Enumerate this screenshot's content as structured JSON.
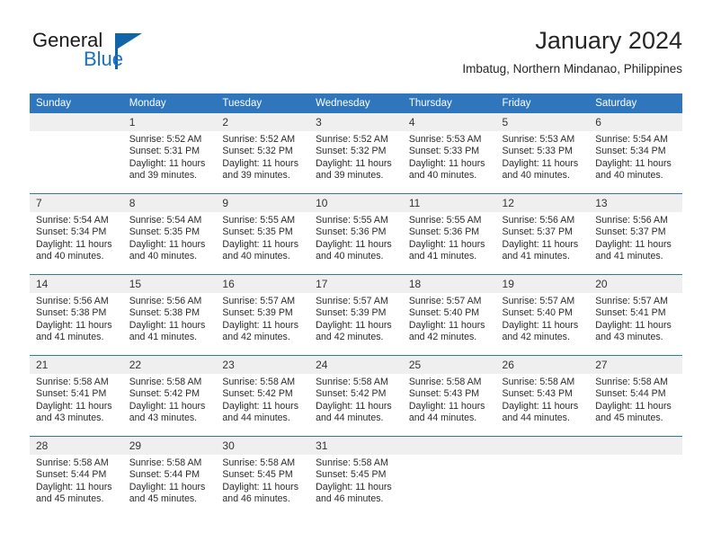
{
  "logo": {
    "word_one": "General",
    "word_two": "Blue",
    "icon": "triangle-icon",
    "accent_color": "#1064a8"
  },
  "header": {
    "month_title": "January 2024",
    "location": "Imbatug, Northern Mindanao, Philippines"
  },
  "theme": {
    "header_bar_color": "#2f76bc",
    "daynum_band_color": "#efefef",
    "text_color": "#2b2b2b"
  },
  "weekday_headers": [
    "Sunday",
    "Monday",
    "Tuesday",
    "Wednesday",
    "Thursday",
    "Friday",
    "Saturday"
  ],
  "weeks": [
    [
      {
        "day": "",
        "sunrise": "",
        "sunset": "",
        "daylight_line1": "",
        "daylight_line2": ""
      },
      {
        "day": "1",
        "sunrise": "Sunrise: 5:52 AM",
        "sunset": "Sunset: 5:31 PM",
        "daylight_line1": "Daylight: 11 hours",
        "daylight_line2": "and 39 minutes."
      },
      {
        "day": "2",
        "sunrise": "Sunrise: 5:52 AM",
        "sunset": "Sunset: 5:32 PM",
        "daylight_line1": "Daylight: 11 hours",
        "daylight_line2": "and 39 minutes."
      },
      {
        "day": "3",
        "sunrise": "Sunrise: 5:52 AM",
        "sunset": "Sunset: 5:32 PM",
        "daylight_line1": "Daylight: 11 hours",
        "daylight_line2": "and 39 minutes."
      },
      {
        "day": "4",
        "sunrise": "Sunrise: 5:53 AM",
        "sunset": "Sunset: 5:33 PM",
        "daylight_line1": "Daylight: 11 hours",
        "daylight_line2": "and 40 minutes."
      },
      {
        "day": "5",
        "sunrise": "Sunrise: 5:53 AM",
        "sunset": "Sunset: 5:33 PM",
        "daylight_line1": "Daylight: 11 hours",
        "daylight_line2": "and 40 minutes."
      },
      {
        "day": "6",
        "sunrise": "Sunrise: 5:54 AM",
        "sunset": "Sunset: 5:34 PM",
        "daylight_line1": "Daylight: 11 hours",
        "daylight_line2": "and 40 minutes."
      }
    ],
    [
      {
        "day": "7",
        "sunrise": "Sunrise: 5:54 AM",
        "sunset": "Sunset: 5:34 PM",
        "daylight_line1": "Daylight: 11 hours",
        "daylight_line2": "and 40 minutes."
      },
      {
        "day": "8",
        "sunrise": "Sunrise: 5:54 AM",
        "sunset": "Sunset: 5:35 PM",
        "daylight_line1": "Daylight: 11 hours",
        "daylight_line2": "and 40 minutes."
      },
      {
        "day": "9",
        "sunrise": "Sunrise: 5:55 AM",
        "sunset": "Sunset: 5:35 PM",
        "daylight_line1": "Daylight: 11 hours",
        "daylight_line2": "and 40 minutes."
      },
      {
        "day": "10",
        "sunrise": "Sunrise: 5:55 AM",
        "sunset": "Sunset: 5:36 PM",
        "daylight_line1": "Daylight: 11 hours",
        "daylight_line2": "and 40 minutes."
      },
      {
        "day": "11",
        "sunrise": "Sunrise: 5:55 AM",
        "sunset": "Sunset: 5:36 PM",
        "daylight_line1": "Daylight: 11 hours",
        "daylight_line2": "and 41 minutes."
      },
      {
        "day": "12",
        "sunrise": "Sunrise: 5:56 AM",
        "sunset": "Sunset: 5:37 PM",
        "daylight_line1": "Daylight: 11 hours",
        "daylight_line2": "and 41 minutes."
      },
      {
        "day": "13",
        "sunrise": "Sunrise: 5:56 AM",
        "sunset": "Sunset: 5:37 PM",
        "daylight_line1": "Daylight: 11 hours",
        "daylight_line2": "and 41 minutes."
      }
    ],
    [
      {
        "day": "14",
        "sunrise": "Sunrise: 5:56 AM",
        "sunset": "Sunset: 5:38 PM",
        "daylight_line1": "Daylight: 11 hours",
        "daylight_line2": "and 41 minutes."
      },
      {
        "day": "15",
        "sunrise": "Sunrise: 5:56 AM",
        "sunset": "Sunset: 5:38 PM",
        "daylight_line1": "Daylight: 11 hours",
        "daylight_line2": "and 41 minutes."
      },
      {
        "day": "16",
        "sunrise": "Sunrise: 5:57 AM",
        "sunset": "Sunset: 5:39 PM",
        "daylight_line1": "Daylight: 11 hours",
        "daylight_line2": "and 42 minutes."
      },
      {
        "day": "17",
        "sunrise": "Sunrise: 5:57 AM",
        "sunset": "Sunset: 5:39 PM",
        "daylight_line1": "Daylight: 11 hours",
        "daylight_line2": "and 42 minutes."
      },
      {
        "day": "18",
        "sunrise": "Sunrise: 5:57 AM",
        "sunset": "Sunset: 5:40 PM",
        "daylight_line1": "Daylight: 11 hours",
        "daylight_line2": "and 42 minutes."
      },
      {
        "day": "19",
        "sunrise": "Sunrise: 5:57 AM",
        "sunset": "Sunset: 5:40 PM",
        "daylight_line1": "Daylight: 11 hours",
        "daylight_line2": "and 42 minutes."
      },
      {
        "day": "20",
        "sunrise": "Sunrise: 5:57 AM",
        "sunset": "Sunset: 5:41 PM",
        "daylight_line1": "Daylight: 11 hours",
        "daylight_line2": "and 43 minutes."
      }
    ],
    [
      {
        "day": "21",
        "sunrise": "Sunrise: 5:58 AM",
        "sunset": "Sunset: 5:41 PM",
        "daylight_line1": "Daylight: 11 hours",
        "daylight_line2": "and 43 minutes."
      },
      {
        "day": "22",
        "sunrise": "Sunrise: 5:58 AM",
        "sunset": "Sunset: 5:42 PM",
        "daylight_line1": "Daylight: 11 hours",
        "daylight_line2": "and 43 minutes."
      },
      {
        "day": "23",
        "sunrise": "Sunrise: 5:58 AM",
        "sunset": "Sunset: 5:42 PM",
        "daylight_line1": "Daylight: 11 hours",
        "daylight_line2": "and 44 minutes."
      },
      {
        "day": "24",
        "sunrise": "Sunrise: 5:58 AM",
        "sunset": "Sunset: 5:42 PM",
        "daylight_line1": "Daylight: 11 hours",
        "daylight_line2": "and 44 minutes."
      },
      {
        "day": "25",
        "sunrise": "Sunrise: 5:58 AM",
        "sunset": "Sunset: 5:43 PM",
        "daylight_line1": "Daylight: 11 hours",
        "daylight_line2": "and 44 minutes."
      },
      {
        "day": "26",
        "sunrise": "Sunrise: 5:58 AM",
        "sunset": "Sunset: 5:43 PM",
        "daylight_line1": "Daylight: 11 hours",
        "daylight_line2": "and 44 minutes."
      },
      {
        "day": "27",
        "sunrise": "Sunrise: 5:58 AM",
        "sunset": "Sunset: 5:44 PM",
        "daylight_line1": "Daylight: 11 hours",
        "daylight_line2": "and 45 minutes."
      }
    ],
    [
      {
        "day": "28",
        "sunrise": "Sunrise: 5:58 AM",
        "sunset": "Sunset: 5:44 PM",
        "daylight_line1": "Daylight: 11 hours",
        "daylight_line2": "and 45 minutes."
      },
      {
        "day": "29",
        "sunrise": "Sunrise: 5:58 AM",
        "sunset": "Sunset: 5:44 PM",
        "daylight_line1": "Daylight: 11 hours",
        "daylight_line2": "and 45 minutes."
      },
      {
        "day": "30",
        "sunrise": "Sunrise: 5:58 AM",
        "sunset": "Sunset: 5:45 PM",
        "daylight_line1": "Daylight: 11 hours",
        "daylight_line2": "and 46 minutes."
      },
      {
        "day": "31",
        "sunrise": "Sunrise: 5:58 AM",
        "sunset": "Sunset: 5:45 PM",
        "daylight_line1": "Daylight: 11 hours",
        "daylight_line2": "and 46 minutes."
      },
      {
        "day": "",
        "sunrise": "",
        "sunset": "",
        "daylight_line1": "",
        "daylight_line2": ""
      },
      {
        "day": "",
        "sunrise": "",
        "sunset": "",
        "daylight_line1": "",
        "daylight_line2": ""
      },
      {
        "day": "",
        "sunrise": "",
        "sunset": "",
        "daylight_line1": "",
        "daylight_line2": ""
      }
    ]
  ]
}
